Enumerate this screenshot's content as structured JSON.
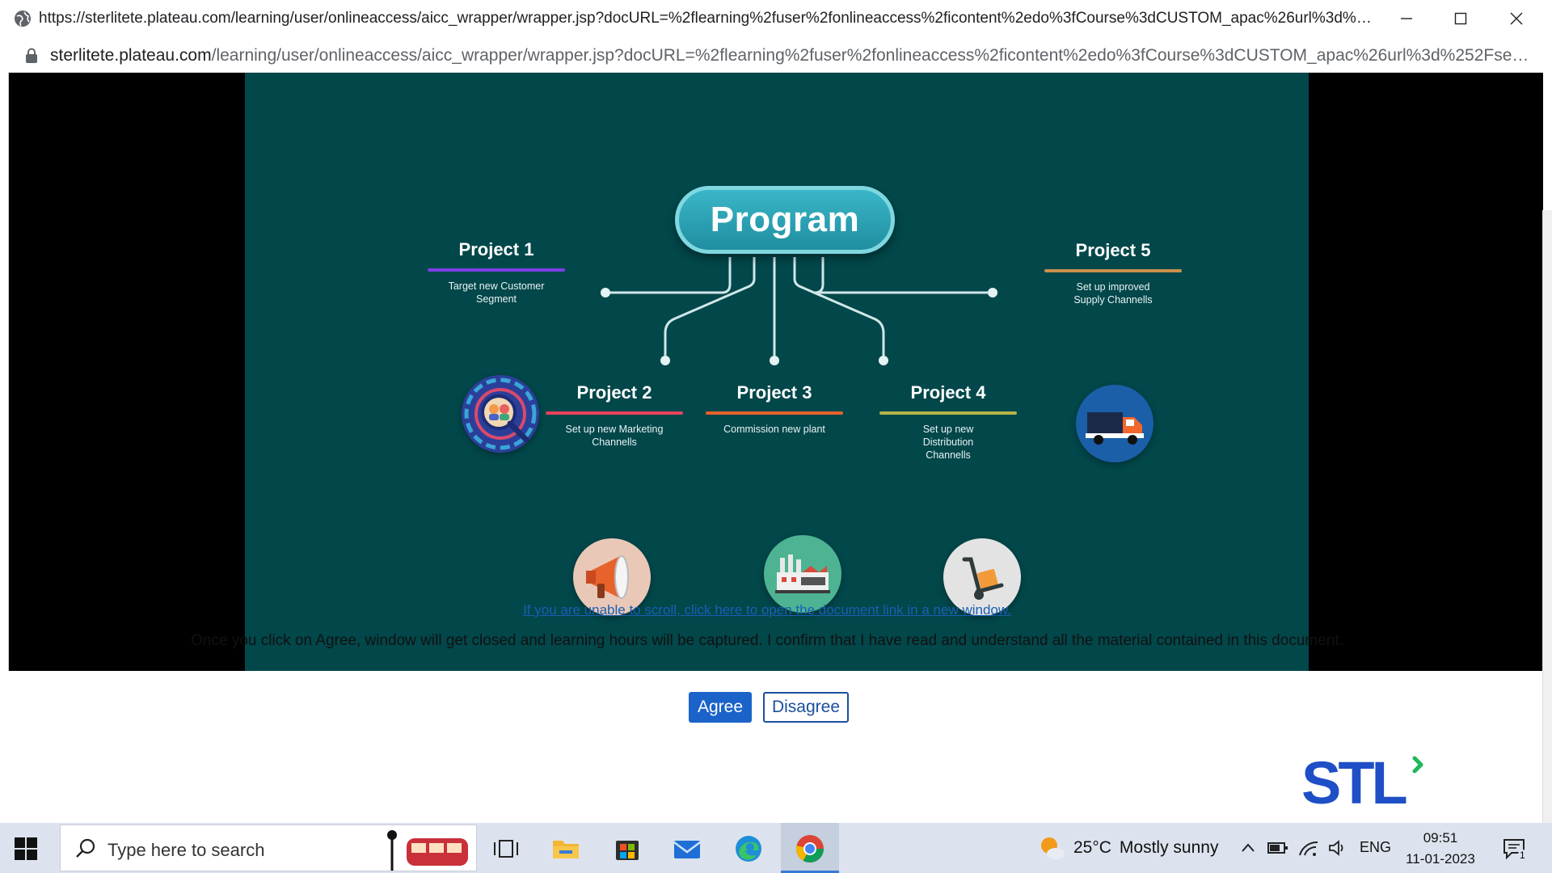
{
  "window": {
    "title_url": "https://sterlitete.plateau.com/learning/user/onlineaccess/aicc_wrapper/wrapper.jsp?docURL=%2flearning%2fuser%2fonlineaccess%2ficontent%2edo%3fCourse%3dCUSTOM_apac%26url%3d%252Fself-mana...",
    "address_host": "sterlitete.plateau.com",
    "address_path": "/learning/user/onlineaccess/aicc_wrapper/wrapper.jsp?docURL=%2flearning%2fuser%2fonlineaccess%2ficontent%2edo%3fCourse%3dCUSTOM_apac%26url%3d%252Fself-m..."
  },
  "slide": {
    "program_label": "Program",
    "projects": [
      {
        "name": "Project 1",
        "desc": "Target new Customer Segment",
        "color": "#7b3fe4",
        "icon": "target-people-icon"
      },
      {
        "name": "Project 2",
        "desc": "Set up new Marketing Channells",
        "color": "#e8425b",
        "icon": "megaphone-icon"
      },
      {
        "name": "Project 3",
        "desc": "Commission new plant",
        "color": "#e8622c",
        "icon": "factory-icon"
      },
      {
        "name": "Project 4",
        "desc": "Set up new Distribution Channells",
        "color": "#b5b548",
        "icon": "hand-truck-icon"
      },
      {
        "name": "Project 5",
        "desc": "Set up improved Supply Channells",
        "color": "#c8914a",
        "icon": "delivery-truck-icon"
      }
    ]
  },
  "document": {
    "open_link": "If you are unable to scroll, click here to open the document link in a new window.",
    "confirm_text": "Once you click on Agree, window will get closed and learning hours will be captured. I confirm that I have read and understand all the material contained in this document.",
    "agree_label": "Agree",
    "disagree_label": "Disagree",
    "logo_text": "STL"
  },
  "taskbar": {
    "search_placeholder": "Type here to search",
    "weather_temp": "25°C",
    "weather_desc": "Mostly sunny",
    "language": "ENG",
    "time": "09:51",
    "date": "11-01-2023",
    "notification_count": "1"
  },
  "colors": {
    "slide_bg": "#02474a",
    "accent_blue": "#1b63c9",
    "logo_blue": "#1f4fc6",
    "logo_green": "#1fb85a"
  }
}
